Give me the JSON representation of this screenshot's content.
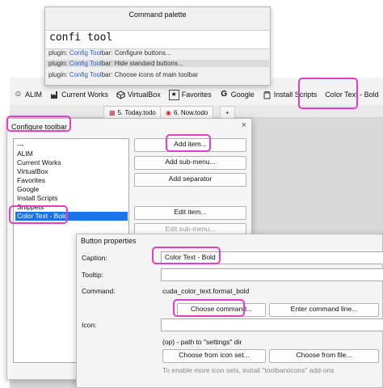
{
  "palette": {
    "title": "Command palette",
    "query": "confi tool",
    "items": [
      {
        "prefix": "plugin: ",
        "hit1": "Config",
        "mid": " ",
        "hit2": "Tool",
        "rest": "bar: Configure buttons..."
      },
      {
        "prefix": "plugin: ",
        "hit1": "Config",
        "mid": " ",
        "hit2": "Tool",
        "rest": "bar: Hide standard buttons..."
      },
      {
        "prefix": "plugin: ",
        "hit1": "Config",
        "mid": " ",
        "hit2": "Tool",
        "rest": "bar: Choose icons of main toolbar"
      }
    ]
  },
  "toolbar": {
    "buttons": [
      {
        "icon": "smiley-icon",
        "label": "ALIM"
      },
      {
        "icon": "factory-icon",
        "label": "Current Works"
      },
      {
        "icon": "box-icon",
        "label": "VirtualBox"
      },
      {
        "icon": "star-icon",
        "label": "Favorites"
      },
      {
        "icon": "google-icon",
        "label": "Google"
      },
      {
        "icon": "script-icon",
        "label": "Install Scripts"
      },
      {
        "icon": "",
        "label": "Color Text - Bold"
      }
    ]
  },
  "tabs": [
    {
      "icon": "calendar-icon",
      "label": "5. Today.todo"
    },
    {
      "icon": "clock-icon",
      "label": "6. Now.todo"
    },
    {
      "icon": "",
      "label": "+"
    }
  ],
  "configure_dialog": {
    "title": "Configure toolbar",
    "close": "×",
    "list_items": [
      "---",
      "ALIM",
      "Current Works",
      "VirtualBox",
      "Favorites",
      "Google",
      "Install Scripts",
      "Snippets",
      "Color Text - Bold"
    ],
    "selected_index": 8,
    "buttons": {
      "add_item": "Add item...",
      "add_submenu": "Add sub-menu...",
      "add_separator": "Add separator",
      "edit_item": "Edit item...",
      "edit_submenu": "Edit sub-menu..."
    }
  },
  "props_dialog": {
    "title": "Button properties",
    "caption_label": "Caption:",
    "caption_value": "Color Text - Bold",
    "tooltip_label": "Tooltip:",
    "tooltip_value": "",
    "command_label": "Command:",
    "command_value": "cuda_color_text.format_bold",
    "choose_command": "Choose command...",
    "enter_command": "Enter command line...",
    "icon_label": "Icon:",
    "icon_value": "",
    "icon_hint": "(op) - path to \"settings\" dir",
    "choose_icon_set": "Choose from icon set...",
    "choose_file": "Choose from file...",
    "footer_hint": "To enable more icon sets, install \"toolbarxicons\" add-ons"
  },
  "colors": {
    "highlight": "#e040c8",
    "selection": "#1a73e8",
    "match": "#2b5fd8"
  }
}
